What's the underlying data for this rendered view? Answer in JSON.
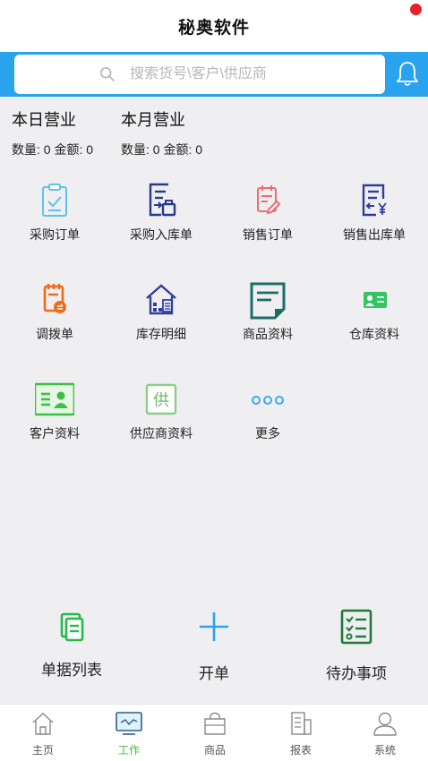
{
  "header": {
    "title": "秘奥软件"
  },
  "search": {
    "placeholder": "搜索货号\\客户\\供应商"
  },
  "stats": [
    {
      "title": "本日营业",
      "qty_label": "数量:",
      "qty": "0",
      "amt_label": "金额:",
      "amt": "0"
    },
    {
      "title": "本月营业",
      "qty_label": "数量:",
      "qty": "0",
      "amt_label": "金额:",
      "amt": "0"
    }
  ],
  "grid": [
    {
      "label": "采购订单",
      "icon": "clipboard-check-icon"
    },
    {
      "label": "采购入库单",
      "icon": "doc-inbox-icon"
    },
    {
      "label": "销售订单",
      "icon": "doc-edit-icon"
    },
    {
      "label": "销售出库单",
      "icon": "doc-yuan-icon"
    },
    {
      "label": "调拨单",
      "icon": "transfer-doc-icon"
    },
    {
      "label": "库存明细",
      "icon": "warehouse-icon"
    },
    {
      "label": "商品资料",
      "icon": "product-doc-icon"
    },
    {
      "label": "仓库资料",
      "icon": "warehouse-card-icon"
    },
    {
      "label": "客户资料",
      "icon": "customer-card-icon"
    },
    {
      "label": "供应商资料",
      "icon": "supplier-icon"
    },
    {
      "label": "更多",
      "icon": "more-dots-icon"
    }
  ],
  "supplier_char": "供",
  "quick": [
    {
      "label": "单据列表",
      "icon": "doc-list-icon"
    },
    {
      "label": "开单",
      "icon": "plus-icon"
    },
    {
      "label": "待办事项",
      "icon": "todo-checklist-icon"
    }
  ],
  "tabs": [
    {
      "label": "主页",
      "icon": "home-icon",
      "active": false
    },
    {
      "label": "工作",
      "icon": "monitor-icon",
      "active": true
    },
    {
      "label": "商品",
      "icon": "bag-icon",
      "active": false
    },
    {
      "label": "报表",
      "icon": "report-icon",
      "active": false
    },
    {
      "label": "系统",
      "icon": "user-icon",
      "active": false
    }
  ],
  "colors": {
    "header_bar": "#2aa3ef",
    "active_tab": "#3dbb39",
    "badge": "#e8202a"
  }
}
